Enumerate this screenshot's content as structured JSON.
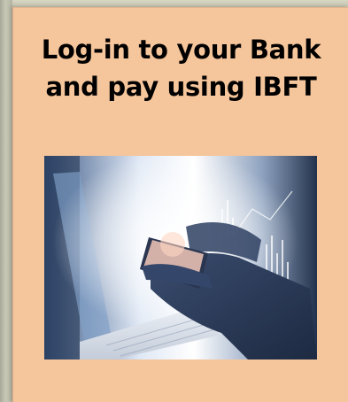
{
  "card": {
    "title_line1": "Log-in to your Bank",
    "title_line2": "and pay using IBFT",
    "background_color": "#f5c59b"
  },
  "photo": {
    "icon": "laptop-phone-finance-photo"
  }
}
